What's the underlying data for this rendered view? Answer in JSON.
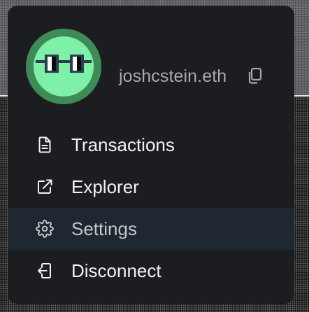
{
  "account": {
    "ens_name": "joshcstein.eth",
    "avatar_icon": "nerd-glasses-avatar-icon",
    "copy_icon": "copy-icon"
  },
  "menu": {
    "items": [
      {
        "label": "Transactions",
        "icon": "document-icon",
        "active": false
      },
      {
        "label": "Explorer",
        "icon": "external-link-icon",
        "active": false
      },
      {
        "label": "Settings",
        "icon": "gear-icon",
        "active": true
      },
      {
        "label": "Disconnect",
        "icon": "exit-door-icon",
        "active": false
      }
    ]
  },
  "colors": {
    "menu_background": "#1c1d20",
    "active_item_background": "#1f2731",
    "avatar_ring": "#3f8b57",
    "avatar_face": "#7ff0a7",
    "text_primary": "#f1f2f3",
    "text_secondary": "#a8a9ad"
  }
}
